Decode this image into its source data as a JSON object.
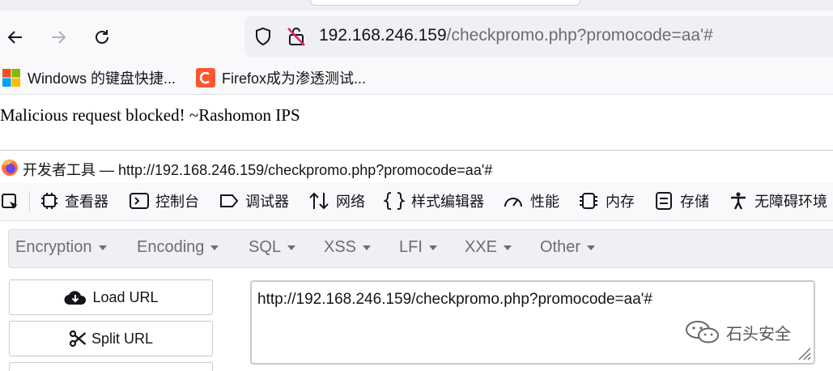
{
  "browser": {
    "url": {
      "host": "192.168.246.159",
      "path": "/checkpromo.php?promocode=aa'#"
    },
    "bookmarks": [
      {
        "label": "Windows 的键盘快捷...",
        "icon": "windows-logo-icon"
      },
      {
        "label": "Firefox成为渗透测试...",
        "icon": "csdn-logo-icon"
      }
    ]
  },
  "page": {
    "message": "Malicious request blocked! ~Rashomon IPS"
  },
  "devtools": {
    "title": "开发者工具 — http://192.168.246.159/checkpromo.php?promocode=aa'#",
    "tabs": [
      "查看器",
      "控制台",
      "调试器",
      "网络",
      "样式编辑器",
      "性能",
      "内存",
      "存储",
      "无障碍环境"
    ]
  },
  "hackbar": {
    "menus": [
      "Encryption",
      "Encoding",
      "SQL",
      "XSS",
      "LFI",
      "XXE",
      "Other"
    ],
    "load_url_label": "Load URL",
    "split_url_label": "Split URL",
    "url_value": "http://192.168.246.159/checkpromo.php?promocode=aa'#"
  },
  "watermark": "石头安全",
  "colors": {
    "accent_red": "#e0245e",
    "csdn_orange": "#fc5531",
    "text_gray": "#6c6c75"
  }
}
